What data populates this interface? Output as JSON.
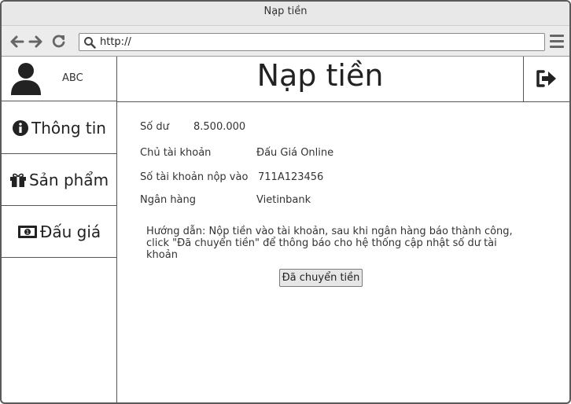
{
  "window": {
    "title": "Nạp tiền"
  },
  "browser": {
    "url": "http://",
    "icons": {
      "back": "arrow-left-icon",
      "forward": "arrow-right-icon",
      "reload": "reload-icon",
      "search": "search-icon",
      "menu": "hamburger-menu-icon"
    }
  },
  "user": {
    "name": "ABC",
    "icon": "user-avatar-icon"
  },
  "sidebar": {
    "items": [
      {
        "label": "Thông tin",
        "icon": "info-circle-icon"
      },
      {
        "label": "Sản phẩm",
        "icon": "gift-icon"
      },
      {
        "label": "Đấu giá",
        "icon": "money-bill-icon"
      }
    ]
  },
  "header": {
    "title": "Nạp tiền",
    "logout_icon": "sign-out-icon"
  },
  "balance": {
    "label": "Số dư",
    "value": "8.500.000"
  },
  "account": {
    "owner_label": "Chủ tài khoản",
    "owner_value": "Đấu Giá Online",
    "number_label": "Số tài khoản nộp vào",
    "number_value": "711A123456",
    "bank_label": "Ngân hàng",
    "bank_value": "Vietinbank"
  },
  "instructions": {
    "line1": "Hướng dẫn: Nộp tiền vào tài khoản, sau khi ngân hàng báo thành công,",
    "line2": "click \"Đã chuyển tiền\" để thông báo cho hệ thống cập nhật số dư tài khoản"
  },
  "actions": {
    "transferred_button": "Đã chuyển tiền"
  }
}
